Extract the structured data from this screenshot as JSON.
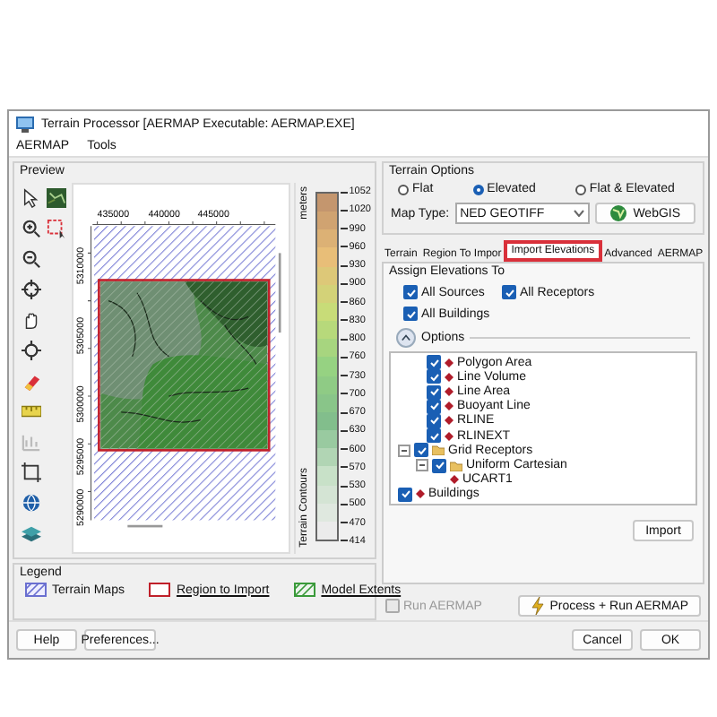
{
  "window": {
    "title": "Terrain Processor [AERMAP Executable: AERMAP.EXE]"
  },
  "menu": [
    "AERMAP",
    "Tools"
  ],
  "preview": {
    "title": "Preview",
    "x_ticks": [
      "435000",
      "440000",
      "445000"
    ],
    "y_ticks": [
      "5310000",
      "5305000",
      "5300000",
      "5295000",
      "5290000"
    ],
    "scale": {
      "unit": "meters",
      "title": "Terrain Contours",
      "labels": [
        "1052",
        "1020",
        "990",
        "960",
        "930",
        "900",
        "860",
        "830",
        "800",
        "760",
        "730",
        "700",
        "670",
        "630",
        "600",
        "570",
        "530",
        "500",
        "470",
        "414"
      ]
    }
  },
  "legend": {
    "title": "Legend",
    "items": [
      {
        "label": "Terrain Maps",
        "kind": "terrain"
      },
      {
        "label": "Region to Import",
        "kind": "region"
      },
      {
        "label": "Model Extents",
        "kind": "extents"
      }
    ]
  },
  "terrain_options": {
    "title": "Terrain Options",
    "options": [
      {
        "label": "Flat",
        "selected": false
      },
      {
        "label": "Elevated",
        "selected": true
      },
      {
        "label": "Flat & Elevated",
        "selected": false
      }
    ],
    "map_type_label": "Map Type:",
    "map_type": "NED GEOTIFF",
    "webgis": "WebGIS"
  },
  "tabs": [
    {
      "label": "Terrain",
      "selected": false
    },
    {
      "label": "Region To Impor",
      "selected": false
    },
    {
      "label": "Import Elevations",
      "selected": true
    },
    {
      "label": "Advanced",
      "selected": false
    },
    {
      "label": "AERMAP",
      "selected": false
    }
  ],
  "assign": {
    "title": "Assign Elevations To",
    "checks": [
      {
        "label": "All Sources",
        "checked": true
      },
      {
        "label": "All Receptors",
        "checked": true
      },
      {
        "label": "All Buildings",
        "checked": true
      }
    ]
  },
  "options_label": "Options",
  "tree": [
    {
      "label": "Polygon Area",
      "kind": "source",
      "checked": true
    },
    {
      "label": "Line Volume",
      "kind": "source",
      "checked": true
    },
    {
      "label": "Line Area",
      "kind": "source",
      "checked": true
    },
    {
      "label": "Buoyant Line",
      "kind": "source",
      "checked": true
    },
    {
      "label": "RLINE",
      "kind": "source",
      "checked": true
    },
    {
      "label": "RLINEXT",
      "kind": "source",
      "checked": true
    },
    {
      "label": "Grid Receptors",
      "kind": "group",
      "checked": true,
      "expanded": true,
      "children": [
        {
          "label": "Uniform Cartesian",
          "kind": "group",
          "checked": true,
          "expanded": true,
          "children": [
            {
              "label": "UCART1",
              "kind": "item"
            }
          ]
        }
      ]
    },
    {
      "label": "Buildings",
      "kind": "item",
      "checked": true
    }
  ],
  "import_button": "Import",
  "run_aermap": {
    "label": "Run AERMAP",
    "checked": false,
    "disabled": true
  },
  "process_button": "Process + Run AERMAP",
  "buttons_left": [
    "Help",
    "Preferences..."
  ],
  "buttons_right": [
    "Cancel",
    "OK"
  ]
}
